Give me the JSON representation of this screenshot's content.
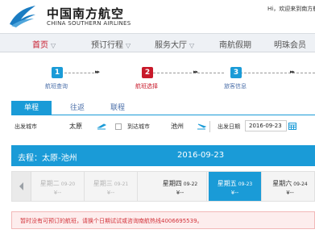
{
  "header": {
    "brand_cn": "中国南方航空",
    "brand_en": "CHINA SOUTHERN AIRLINES",
    "welcome": "Hi，欢迎来到南方航"
  },
  "nav": {
    "items": [
      {
        "label": "首页",
        "active": true
      },
      {
        "label": "预订行程"
      },
      {
        "label": "服务大厅"
      },
      {
        "label": "南航假期"
      },
      {
        "label": "明珠会员"
      }
    ]
  },
  "steps": [
    {
      "number": "1",
      "label": "航班查询",
      "color": "#1a9bd7"
    },
    {
      "number": "2",
      "label": "航班选择",
      "color": "#c8192a"
    },
    {
      "number": "3",
      "label": "旅客信息",
      "color": "#1a9bd7"
    }
  ],
  "tabs": [
    {
      "label": "单程"
    },
    {
      "label": "往返"
    },
    {
      "label": "联程"
    }
  ],
  "search": {
    "from_label": "出发城市",
    "from_value": "太原",
    "to_label": "到达城市",
    "to_value": "池州",
    "date_label": "出发日期",
    "date_value": "2016-09-23"
  },
  "route": {
    "text": "去程：太原-池州",
    "date": "2016-09-23"
  },
  "dates": [
    {
      "day": "星期二",
      "date": "09-20",
      "price": "¥--",
      "state": "past"
    },
    {
      "day": "星期三",
      "date": "09-21",
      "price": "¥--",
      "state": "past"
    },
    {
      "day": "星期四",
      "date": "09-22",
      "price": "¥--",
      "state": "future"
    },
    {
      "day": "星期五",
      "date": "09-23",
      "price": "¥--",
      "state": "active"
    },
    {
      "day": "星期六",
      "date": "09-24",
      "price": "¥--",
      "state": "future"
    }
  ],
  "alert": {
    "text": "暂时没有可预订的航班，请换个日期试试或咨询南航热线4006695539。"
  },
  "colors": {
    "accent": "#1a9bd7",
    "brand_red": "#c8192a",
    "alert_text": "#d2323a"
  },
  "icons": [
    "airline-logo-icon",
    "chevron-down-icon",
    "departure-plane-icon",
    "arrival-plane-icon",
    "calendar-icon",
    "chevron-left-icon"
  ]
}
